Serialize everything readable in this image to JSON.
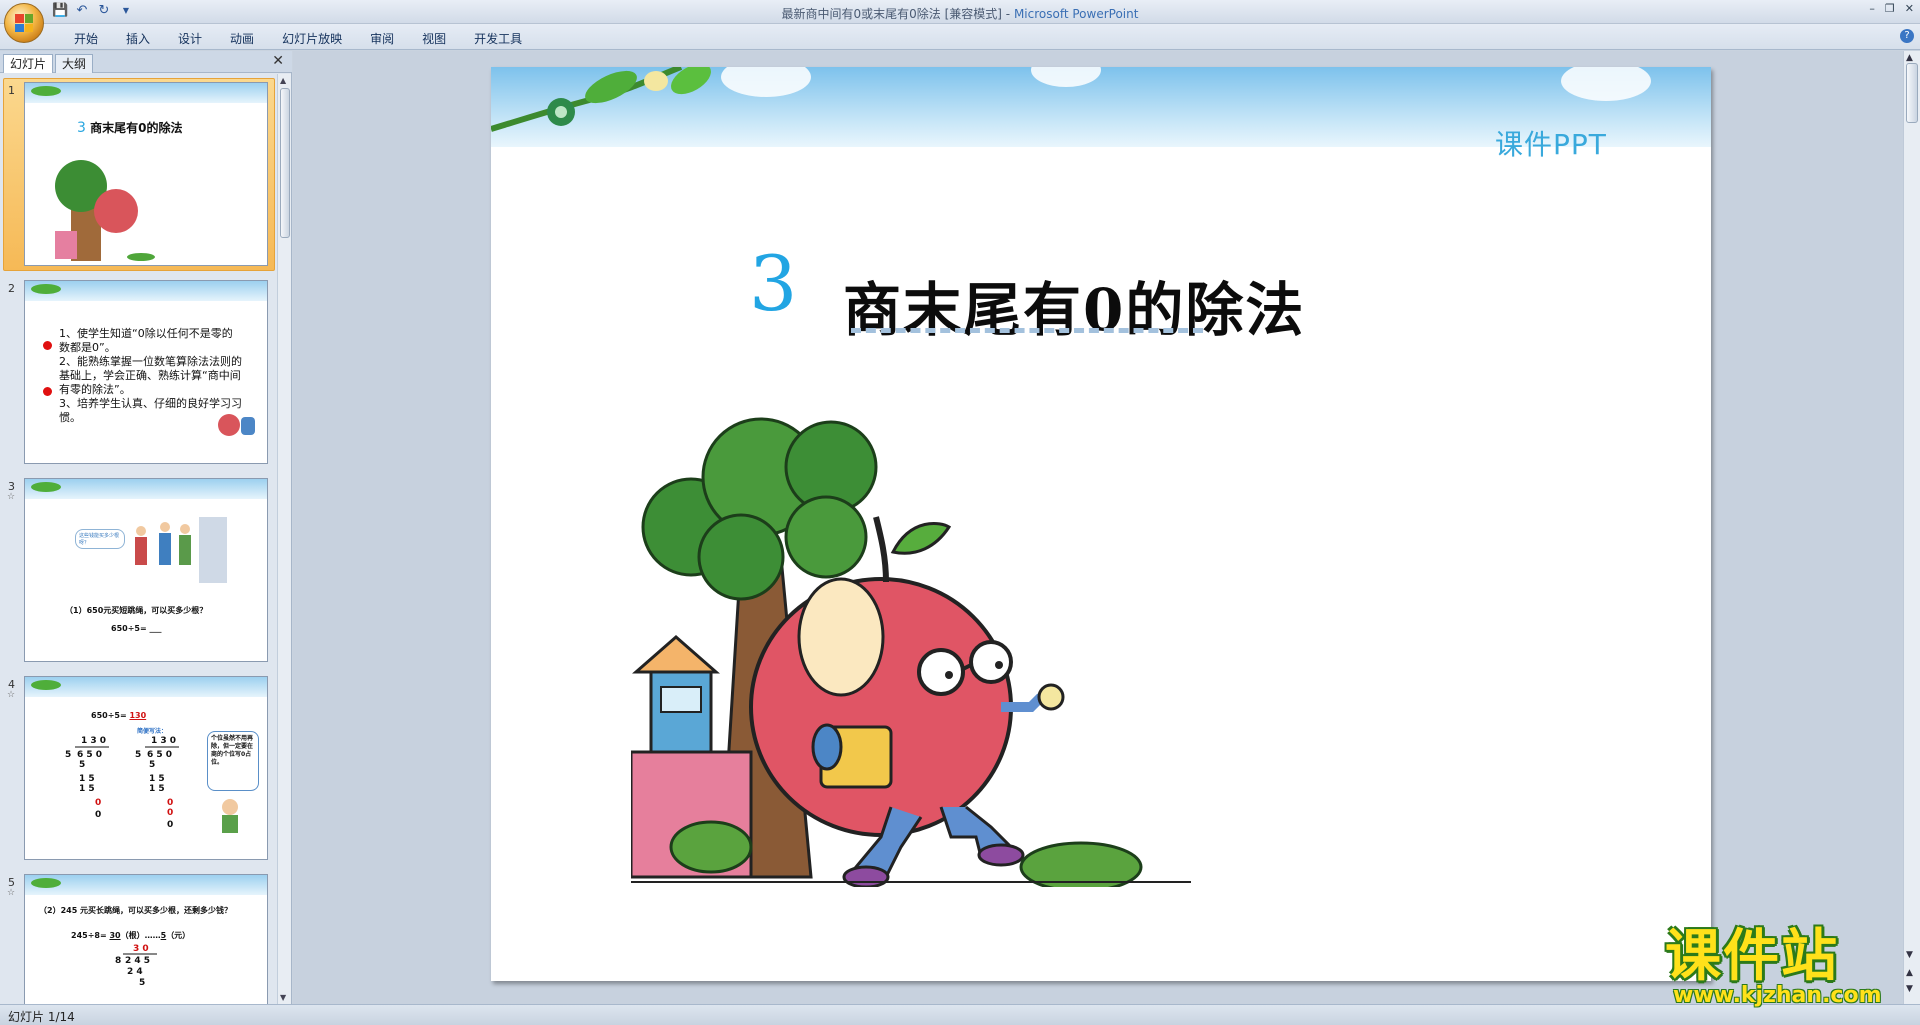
{
  "window": {
    "title": "最新商中间有0或末尾有0除法 [兼容模式] - Microsoft PowerPoint",
    "title_doc": "最新商中间有0或末尾有0除法 [兼容模式]",
    "title_app": "Microsoft PowerPoint",
    "controls": [
      "minimize-icon",
      "restore-icon",
      "close-icon"
    ]
  },
  "quick_access": [
    "save-icon",
    "undo-icon",
    "redo-icon",
    "customize-icon"
  ],
  "ribbon": {
    "tabs": [
      "开始",
      "插入",
      "设计",
      "动画",
      "幻灯片放映",
      "审阅",
      "视图",
      "开发工具"
    ],
    "help_glyph": "?"
  },
  "panel": {
    "tabs": [
      "幻灯片",
      "大纲"
    ],
    "close_glyph": "✕",
    "slides": [
      {
        "num": "1",
        "title_num": "3",
        "title": "商末尾有0的除法"
      },
      {
        "num": "2",
        "lines": [
          "1、使学生知道“0除以任何不是零的",
          "数都是0”。",
          "2、能熟练掌握一位数笔算除法法则的",
          "基础上，学会正确、熟练计算“商中间",
          "有零的除法”。",
          "3、培养学生认真、仔细的良好学习习",
          "惯。"
        ]
      },
      {
        "num": "3",
        "question": "（1）650元买短跳绳，可以买多少根？",
        "equation": "650÷5=",
        "bubble": "这些钱能买多少根呀？"
      },
      {
        "num": "4",
        "equation": "650÷5=",
        "answer": "130",
        "method": "简便写法：",
        "note": "个位虽然不用再除，但一定要在商的个位写0占位。"
      },
      {
        "num": "5",
        "question": "（2）245 元买长跳绳，可以买多少根，还剩多少钱？",
        "equation": "245÷8=",
        "answer1": "30",
        "unit1": "（根）",
        "sep": "……",
        "answer2": "5",
        "unit2": "（元）"
      }
    ]
  },
  "status": {
    "text": "幻灯片 1/14"
  },
  "slide": {
    "brand": "课件PPT",
    "number": "3",
    "title": "商末尾有0的除法"
  },
  "watermark": {
    "name": "课件站",
    "url": "www.kjzhan.com"
  }
}
